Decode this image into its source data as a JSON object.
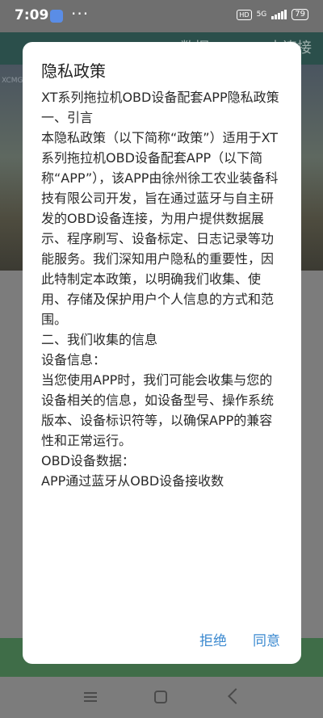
{
  "status_bar": {
    "time": "7:09",
    "dots": "···",
    "hd": "HD",
    "signal": "5G",
    "battery": "79"
  },
  "background": {
    "header_title": "XG OBD 数据",
    "header_right": "未连接",
    "hero_tag": "XCMG"
  },
  "dialog": {
    "title": "隐私政策",
    "paragraphs": [
      "XT系列拖拉机OBD设备配套APP隐私政策",
      "",
      "一、引言",
      "",
      "本隐私政策（以下简称“政策”）适用于XT系列拖拉机OBD设备配套APP（以下简称“APP”），该APP由徐州徐工农业装备科技有限公司开发，旨在通过蓝牙与自主研发的OBD设备连接，为用户提供数据展示、程序刷写、设备标定、日志记录等功能服务。我们深知用户隐私的重要性，因此特制定本政策，以明确我们收集、使用、存储及保护用户个人信息的方式和范围。",
      "",
      "二、我们收集的信息",
      "",
      "设备信息：",
      "当您使用APP时，我们可能会收集与您的设备相关的信息，如设备型号、操作系统版本、设备标识符等，以确保APP的兼容性和正常运行。",
      "OBD设备数据：",
      "APP通过蓝牙从OBD设备接收数"
    ],
    "reject_label": "拒绝",
    "agree_label": "同意"
  }
}
